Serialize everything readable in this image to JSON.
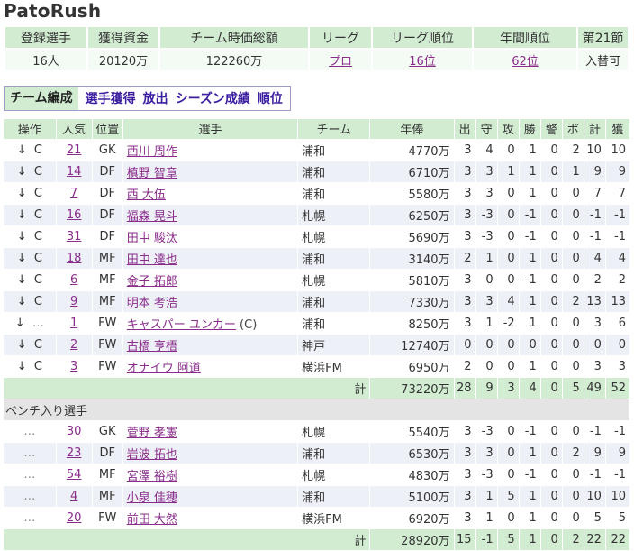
{
  "app": {
    "title": "PatoRush"
  },
  "summary": {
    "headers": [
      "登録選手",
      "獲得資金",
      "チーム時価総額",
      "リーグ",
      "リーグ順位",
      "年間順位",
      "第21節"
    ],
    "values": [
      "16人",
      "20120万",
      "122260万",
      "プロ",
      "16位",
      "62位",
      "入替可"
    ]
  },
  "tabs": [
    "チーム編成",
    "選手獲得",
    "放出",
    "シーズン成績",
    "順位"
  ],
  "columns": [
    "操作",
    "人気",
    "位置",
    "選手",
    "チーム",
    "年俸",
    "出",
    "守",
    "攻",
    "勝",
    "警",
    "ボ",
    "計",
    "獲"
  ],
  "starters": [
    {
      "op": "↓",
      "op2": "C",
      "pop": "21",
      "pos": "GK",
      "name": "西川 周作",
      "team": "浦和",
      "salary": "4770万",
      "s": [
        "3",
        "4",
        "0",
        "1",
        "0",
        "2",
        "10",
        "10"
      ]
    },
    {
      "op": "↓",
      "op2": "C",
      "pop": "14",
      "pos": "DF",
      "name": "槙野 智章",
      "team": "浦和",
      "salary": "6710万",
      "s": [
        "3",
        "3",
        "1",
        "1",
        "0",
        "1",
        "9",
        "9"
      ]
    },
    {
      "op": "↓",
      "op2": "C",
      "pop": "7",
      "pos": "DF",
      "name": "西 大伍",
      "team": "浦和",
      "salary": "5580万",
      "s": [
        "3",
        "3",
        "0",
        "1",
        "0",
        "0",
        "7",
        "7"
      ]
    },
    {
      "op": "↓",
      "op2": "C",
      "pop": "16",
      "pos": "DF",
      "name": "福森 晃斗",
      "team": "札幌",
      "salary": "6250万",
      "s": [
        "3",
        "-3",
        "0",
        "-1",
        "0",
        "0",
        "-1",
        "-1"
      ]
    },
    {
      "op": "↓",
      "op2": "C",
      "pop": "31",
      "pos": "DF",
      "name": "田中 駿汰",
      "team": "札幌",
      "salary": "5690万",
      "s": [
        "3",
        "-3",
        "0",
        "-1",
        "0",
        "0",
        "-1",
        "-1"
      ]
    },
    {
      "op": "↓",
      "op2": "C",
      "pop": "18",
      "pos": "MF",
      "name": "田中 達也",
      "team": "浦和",
      "salary": "3140万",
      "s": [
        "2",
        "1",
        "0",
        "1",
        "0",
        "0",
        "4",
        "4"
      ]
    },
    {
      "op": "↓",
      "op2": "C",
      "pop": "6",
      "pos": "MF",
      "name": "金子 拓郎",
      "team": "札幌",
      "salary": "5810万",
      "s": [
        "3",
        "0",
        "0",
        "-1",
        "0",
        "0",
        "2",
        "2"
      ]
    },
    {
      "op": "↓",
      "op2": "C",
      "pop": "9",
      "pos": "MF",
      "name": "明本 考浩",
      "team": "浦和",
      "salary": "7330万",
      "s": [
        "3",
        "3",
        "4",
        "1",
        "0",
        "2",
        "13",
        "13"
      ]
    },
    {
      "op": "↓",
      "op2": "…",
      "pop": "1",
      "pos": "FW",
      "name": "キャスパー ユンカー",
      "cap": "(C)",
      "team": "浦和",
      "salary": "8250万",
      "s": [
        "3",
        "1",
        "-2",
        "1",
        "0",
        "0",
        "3",
        "6"
      ]
    },
    {
      "op": "↓",
      "op2": "C",
      "pop": "2",
      "pos": "FW",
      "name": "古橋 亨梧",
      "team": "神戸",
      "salary": "12740万",
      "s": [
        "0",
        "0",
        "0",
        "0",
        "0",
        "0",
        "0",
        "0"
      ]
    },
    {
      "op": "↓",
      "op2": "C",
      "pop": "3",
      "pos": "FW",
      "name": "オナイウ 阿道",
      "team": "横浜FM",
      "salary": "6950万",
      "s": [
        "2",
        "0",
        "0",
        "1",
        "0",
        "0",
        "3",
        "3"
      ]
    }
  ],
  "starters_total": {
    "label": "計",
    "salary": "73220万",
    "s": [
      "28",
      "9",
      "3",
      "4",
      "0",
      "5",
      "49",
      "52"
    ]
  },
  "bench_label": "ベンチ入り選手",
  "bench": [
    {
      "op": "…",
      "pop": "30",
      "pos": "GK",
      "name": "菅野 孝憲",
      "team": "札幌",
      "salary": "5540万",
      "s": [
        "3",
        "-3",
        "0",
        "-1",
        "0",
        "0",
        "-1",
        "-1"
      ]
    },
    {
      "op": "…",
      "pop": "23",
      "pos": "DF",
      "name": "岩波 拓也",
      "team": "浦和",
      "salary": "6530万",
      "s": [
        "3",
        "3",
        "0",
        "1",
        "0",
        "2",
        "9",
        "9"
      ]
    },
    {
      "op": "…",
      "pop": "54",
      "pos": "MF",
      "name": "宮澤 裕樹",
      "team": "札幌",
      "salary": "4830万",
      "s": [
        "3",
        "-3",
        "0",
        "-1",
        "0",
        "0",
        "-1",
        "-1"
      ]
    },
    {
      "op": "…",
      "pop": "4",
      "pos": "MF",
      "name": "小泉 佳穂",
      "team": "浦和",
      "salary": "5100万",
      "s": [
        "3",
        "1",
        "5",
        "1",
        "0",
        "0",
        "10",
        "10"
      ]
    },
    {
      "op": "…",
      "pop": "20",
      "pos": "FW",
      "name": "前田 大然",
      "team": "横浜FM",
      "salary": "6920万",
      "s": [
        "3",
        "1",
        "0",
        "1",
        "0",
        "0",
        "5",
        "5"
      ]
    }
  ],
  "bench_total": {
    "label": "計",
    "salary": "28920万",
    "s": [
      "15",
      "-1",
      "5",
      "1",
      "0",
      "2",
      "22",
      "22"
    ]
  },
  "colors": {
    "header_bg": "#d2ecd2",
    "row_alt": "#eef0f8",
    "link": "#8a2d8a",
    "tab_text": "#3c1ea0"
  }
}
